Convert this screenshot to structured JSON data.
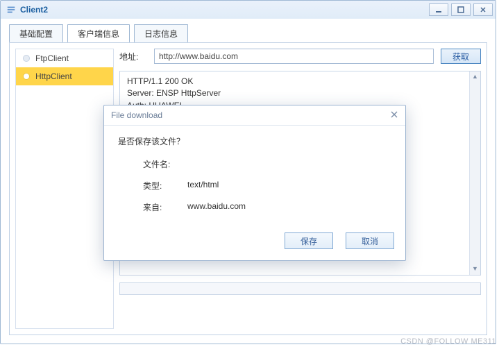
{
  "window": {
    "title": "Client2"
  },
  "tabs": [
    {
      "label": "基础配置"
    },
    {
      "label": "客户端信息"
    },
    {
      "label": "日志信息"
    }
  ],
  "sidebar": {
    "items": [
      {
        "label": "FtpClient"
      },
      {
        "label": "HttpClient"
      }
    ]
  },
  "content": {
    "addr_label": "地址:",
    "addr_value": "http://www.baidu.com",
    "fetch_label": "获取",
    "response_lines": {
      "l1": "HTTP/1.1 200 OK",
      "l2": "Server: ENSP HttpServer",
      "l3": "Auth: HUAWEI"
    }
  },
  "dialog": {
    "title": "File download",
    "question": "是否保存该文件？",
    "rows": {
      "filename_k": "文件名:",
      "filename_v": "",
      "type_k": "类型:",
      "type_v": "text/html",
      "from_k": "来自:",
      "from_v": "www.baidu.com"
    },
    "save": "保存",
    "cancel": "取消"
  },
  "watermark": "CSDN @FOLLOW ME311"
}
